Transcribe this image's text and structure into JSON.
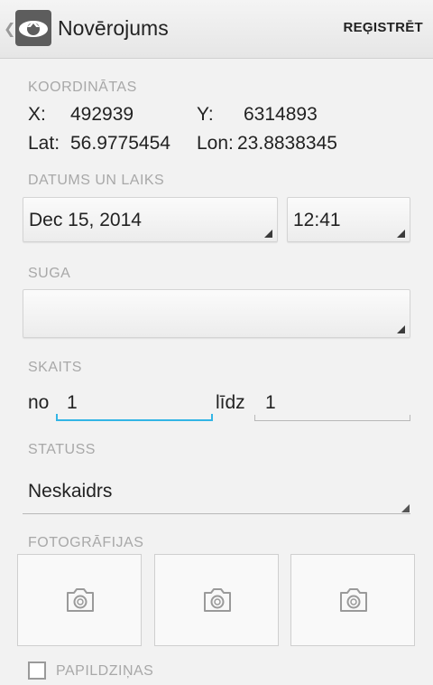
{
  "header": {
    "title": "Novērojums",
    "action_label": "REĢISTRĒT",
    "up_glyph": "❮"
  },
  "coordinates": {
    "section_label": "KOORDINĀTAS",
    "x_label": "X:",
    "x_value": "492939",
    "y_label": "Y:",
    "y_value": "6314893",
    "lat_label": "Lat:",
    "lat_value": "56.9775454",
    "lon_label": "Lon:",
    "lon_value": "23.8838345"
  },
  "datetime": {
    "section_label": "DATUMS UN LAIKS",
    "date_value": "Dec 15, 2014",
    "time_value": "12:41"
  },
  "species": {
    "section_label": "SUGA",
    "value": ""
  },
  "count": {
    "section_label": "SKAITS",
    "from_label": "no",
    "from_value": "1",
    "to_label": "līdz",
    "to_value": "1"
  },
  "status": {
    "section_label": "STATUSS",
    "value": "Neskaidrs"
  },
  "photos": {
    "section_label": "FOTOGRĀFIJAS",
    "slots": [
      "camera-icon",
      "camera-icon",
      "camera-icon"
    ]
  },
  "extra": {
    "label": "PAPILDZIŅAS",
    "checked": false
  },
  "colors": {
    "accent": "#33b5e5",
    "section_label": "#a8a8a8"
  }
}
